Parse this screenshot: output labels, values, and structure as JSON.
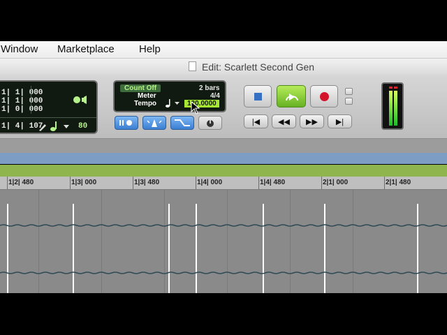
{
  "menubar": {
    "items": [
      "Window",
      "Marketplace",
      "Help"
    ]
  },
  "window": {
    "title": "Edit: Scarlett Second Gen"
  },
  "counter": {
    "lines": [
      "1| 1| 000",
      "1| 1| 000",
      "1| 0| 000",
      "1| 4| 107"
    ],
    "value": "80"
  },
  "tempo_panel": {
    "count_off": "Count Off",
    "bars": "2 bars",
    "meter_label": "Meter",
    "meter_value": "4/4",
    "tempo_label": "Tempo",
    "tempo_value": "120.0000"
  },
  "ruler": {
    "labels": [
      "1|2| 480",
      "1|3| 000",
      "1|3| 480",
      "1|4| 000",
      "1|4| 480",
      "2|1| 000",
      "2|1| 480"
    ]
  },
  "colors": {
    "play_green": "#7ccc2e",
    "record_red": "#d3142a",
    "ruler_bg": "#bfbfbf"
  },
  "icons": [
    "document-icon",
    "speaker-icon",
    "note-icon",
    "pencil-icon",
    "stop-icon",
    "play-loop-icon",
    "record-icon",
    "rewind-to-start-icon",
    "rewind-icon",
    "fast-forward-icon",
    "go-to-end-icon"
  ]
}
